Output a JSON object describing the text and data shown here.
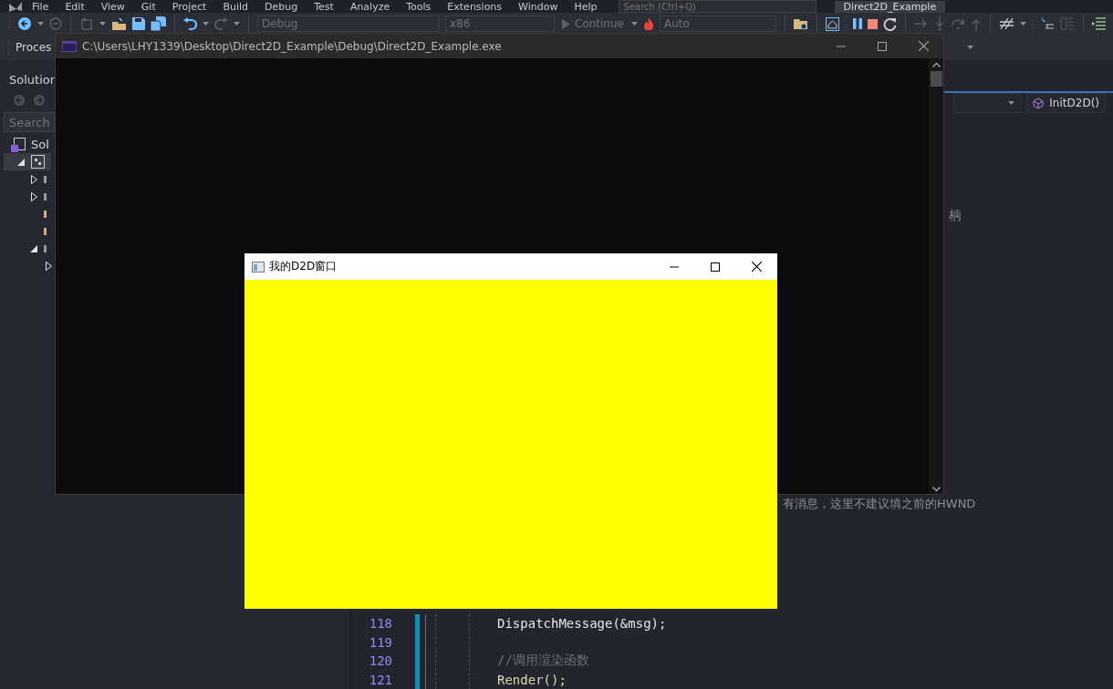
{
  "ide": {
    "menu": [
      "File",
      "Edit",
      "View",
      "Git",
      "Project",
      "Build",
      "Debug",
      "Test",
      "Analyze",
      "Tools",
      "Extensions",
      "Window",
      "Help"
    ],
    "search": {
      "placeholder": "Search (Ctrl+Q)"
    },
    "solution_name": "Direct2D_Example",
    "toolbar": {
      "configuration": "Debug",
      "platform": "x86",
      "continue": "Continue",
      "stack_frame": "Auto"
    },
    "process_label": "Proces",
    "solution_explorer": {
      "title": "Solution",
      "search": {
        "placeholder": "Search"
      },
      "tree": [
        {
          "label": "Sol",
          "kind": "solution",
          "children": [
            {
              "kind": "project",
              "selected": true,
              "expanded": true,
              "children": [
                {
                  "kind": "folder",
                  "selected": false,
                  "expanded": false
                },
                {
                  "kind": "folder",
                  "selected": false,
                  "expanded": false
                },
                {
                  "kind": "file",
                  "selected": false
                },
                {
                  "kind": "file",
                  "selected": false
                },
                {
                  "kind": "folder",
                  "selected": false,
                  "expanded": true,
                  "children": [
                    {
                      "selected": false,
                      "expanded": false
                    }
                  ]
                }
              ]
            }
          ]
        }
      ]
    },
    "editor": {
      "member": "InitD2D()",
      "fragments": [
        "柄",
        "有消息，这里不建议填之前的HWND"
      ],
      "lines": [
        {
          "number": "118",
          "text": "DispatchMessage(&msg);",
          "kind": "call"
        },
        {
          "number": "119"
        },
        {
          "number": "120",
          "text": "//调用渲染函数",
          "kind": "comment"
        },
        {
          "number": "121",
          "text": "Render();",
          "kind": "function"
        }
      ]
    }
  },
  "console_window": {
    "title": "C:\\Users\\LHY1339\\Desktop\\Direct2D_Example\\Debug\\Direct2D_Example.exe"
  },
  "d2d_window": {
    "title": "我的D2D窗口"
  }
}
